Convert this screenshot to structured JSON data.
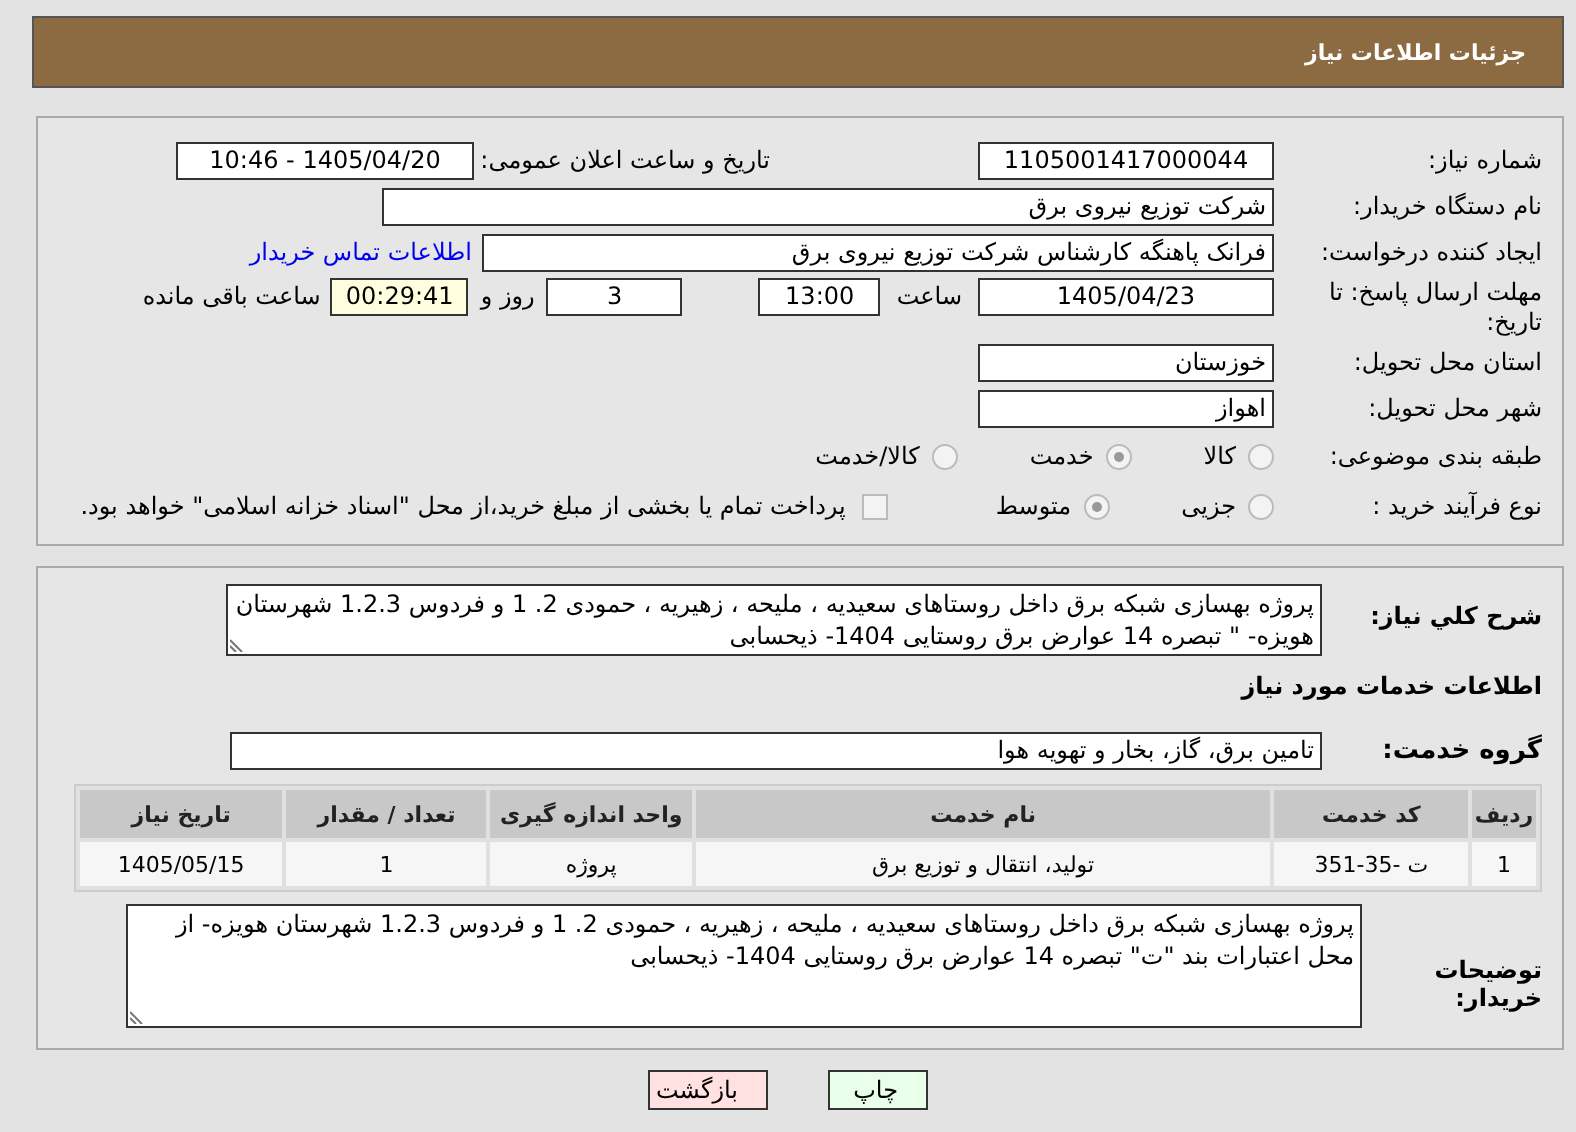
{
  "header": {
    "title": "جزئیات اطلاعات نیاز"
  },
  "need_number": {
    "label": "شماره نیاز:",
    "value": "1105001417000044"
  },
  "announce": {
    "label": "تاریخ و ساعت اعلان عمومی:",
    "value": "1405/04/20 - 10:46"
  },
  "buyer_org": {
    "label": "نام دستگاه خریدار:",
    "value": "شرکت توزیع نیروی برق"
  },
  "creator": {
    "label": "ایجاد کننده درخواست:",
    "value": "فرانک  پاهنگه کارشناس  شرکت توزیع نیروی برق",
    "link": "اطلاعات تماس خریدار"
  },
  "deadline": {
    "label": "مهلت ارسال پاسخ: تا تاریخ:",
    "date": "1405/04/23",
    "time_label": "ساعت",
    "time": "13:00",
    "days": "3",
    "days_label": "روز و",
    "remaining": "00:29:41",
    "remaining_label": "ساعت باقی مانده"
  },
  "province": {
    "label": "استان محل تحویل:",
    "value": "خوزستان"
  },
  "city": {
    "label": "شهر محل تحویل:",
    "value": "اهواز"
  },
  "category": {
    "label": "طبقه بندی موضوعی:",
    "options": [
      {
        "label": "کالا",
        "selected": false
      },
      {
        "label": "خدمت",
        "selected": true
      },
      {
        "label": "کالا/خدمت",
        "selected": false
      }
    ]
  },
  "purchase_type": {
    "label": "نوع فرآیند خرید :",
    "options": [
      {
        "label": "جزیی",
        "selected": false
      },
      {
        "label": "متوسط",
        "selected": true
      }
    ],
    "payment": {
      "checked": false,
      "label": "پرداخت تمام یا بخشی از مبلغ خرید،از محل \"اسناد خزانه اسلامی\" خواهد بود."
    }
  },
  "summary": {
    "label": "شرح کلي نياز:",
    "value": "پروژه بهسازی شبکه برق داخل روستاهای  سعیدیه ، ملیحه ، زهیریه ، حمودی 2. 1 و فردوس 1.2.3 شهرستان هویزه- \" تبصره 14 عوارض برق روستایی 1404- ذیحسابی"
  },
  "services_heading": "اطلاعات خدمات مورد نیاز",
  "service_group": {
    "label": "گروه خدمت:",
    "value": "تامین برق، گاز، بخار و تهویه هوا"
  },
  "table": {
    "columns": [
      "ردیف",
      "کد خدمت",
      "نام خدمت",
      "واحد اندازه گیری",
      "تعداد / مقدار",
      "تاریخ نیاز"
    ],
    "rows": [
      [
        "1",
        "ت -35-351",
        "تولید، انتقال و توزیع برق",
        "پروژه",
        "1",
        "1405/05/15"
      ]
    ]
  },
  "buyer_notes": {
    "label": "توضیحات خریدار:",
    "value": "پروژه بهسازی شبکه برق داخل روستاهای  سعیدیه ، ملیحه ، زهیریه ، حمودی 2. 1 و فردوس 1.2.3 شهرستان هویزه- از محل اعتبارات بند \"ت\" تبصره 14 عوارض برق روستایی 1404- ذیحسابی"
  },
  "buttons": [
    {
      "label": "چاپ",
      "kind": "print"
    },
    {
      "label": "بازگشت",
      "kind": "back"
    }
  ]
}
